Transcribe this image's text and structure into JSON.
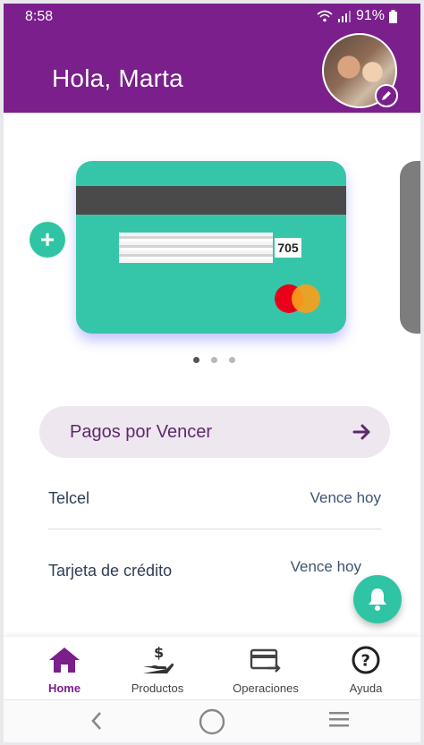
{
  "status_bar": {
    "time": "8:58",
    "battery": "91%"
  },
  "header": {
    "greeting": "Hola, Marta"
  },
  "card": {
    "cvv": "705",
    "brand_colors": {
      "red": "#eb001b",
      "orange": "#f79e1b"
    }
  },
  "carousel": {
    "dots": 3,
    "active_index": 0
  },
  "pagos": {
    "title": "Pagos por Vencer"
  },
  "due_items": [
    {
      "label": "Telcel",
      "status": "Vence hoy"
    },
    {
      "label": "Tarjeta de crédito",
      "status": "Vence hoy"
    }
  ],
  "bottom_nav": [
    {
      "label": "Home",
      "icon": "home-icon",
      "active": true
    },
    {
      "label": "Productos",
      "icon": "hand-dollar-icon",
      "active": false
    },
    {
      "label": "Operaciones",
      "icon": "card-transfer-icon",
      "active": false
    },
    {
      "label": "Ayuda",
      "icon": "help-icon",
      "active": false
    }
  ],
  "colors": {
    "primary": "#7a1f8c",
    "accent": "#2fc4a4",
    "card": "#35c6aa"
  }
}
